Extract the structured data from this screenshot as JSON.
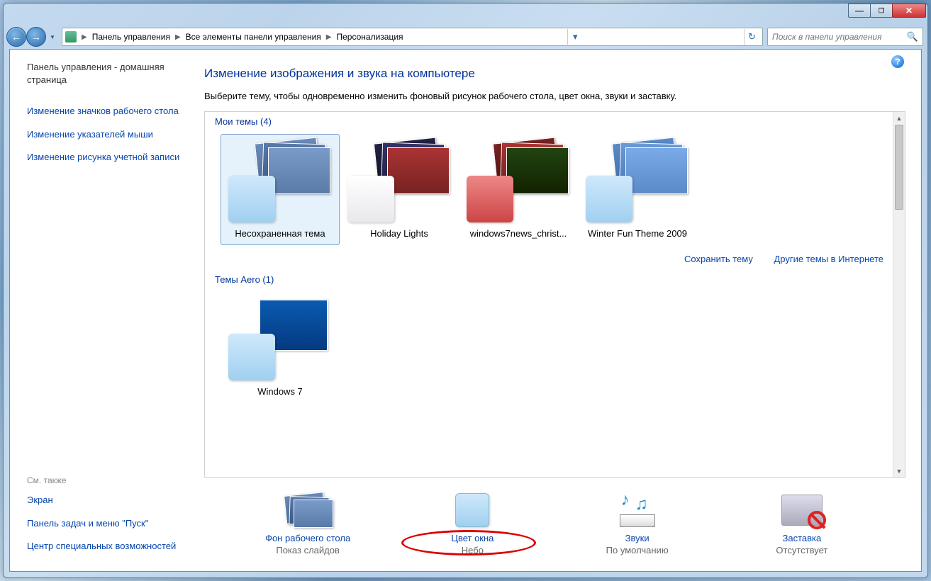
{
  "breadcrumbs": {
    "item1": "Панель управления",
    "item2": "Все элементы панели управления",
    "item3": "Персонализация"
  },
  "search": {
    "placeholder": "Поиск в панели управления"
  },
  "sidebar": {
    "home": "Панель управления - домашняя страница",
    "link1": "Изменение значков рабочего стола",
    "link2": "Изменение указателей мыши",
    "link3": "Изменение рисунка учетной записи",
    "see_also": "См. также",
    "link4": "Экран",
    "link5": "Панель задач и меню \"Пуск\"",
    "link6": "Центр специальных возможностей"
  },
  "main": {
    "title": "Изменение изображения и звука на компьютере",
    "desc": "Выберите тему, чтобы одновременно изменить фоновый рисунок рабочего стола, цвет окна, звуки и заставку.",
    "section1": "Мои темы (4)",
    "section2": "Темы Aero (1)",
    "themes": {
      "t1": "Несохраненная тема",
      "t2": "Holiday Lights",
      "t3": "windows7news_christ...",
      "t4": "Winter Fun Theme 2009",
      "t5": "Windows 7"
    },
    "actions": {
      "save": "Сохранить тему",
      "more": "Другие темы в Интернете"
    }
  },
  "bottom": {
    "b1": {
      "title": "Фон рабочего стола",
      "sub": "Показ слайдов"
    },
    "b2": {
      "title": "Цвет окна",
      "sub": "Небо"
    },
    "b3": {
      "title": "Звуки",
      "sub": "По умолчанию"
    },
    "b4": {
      "title": "Заставка",
      "sub": "Отсутствует"
    }
  }
}
